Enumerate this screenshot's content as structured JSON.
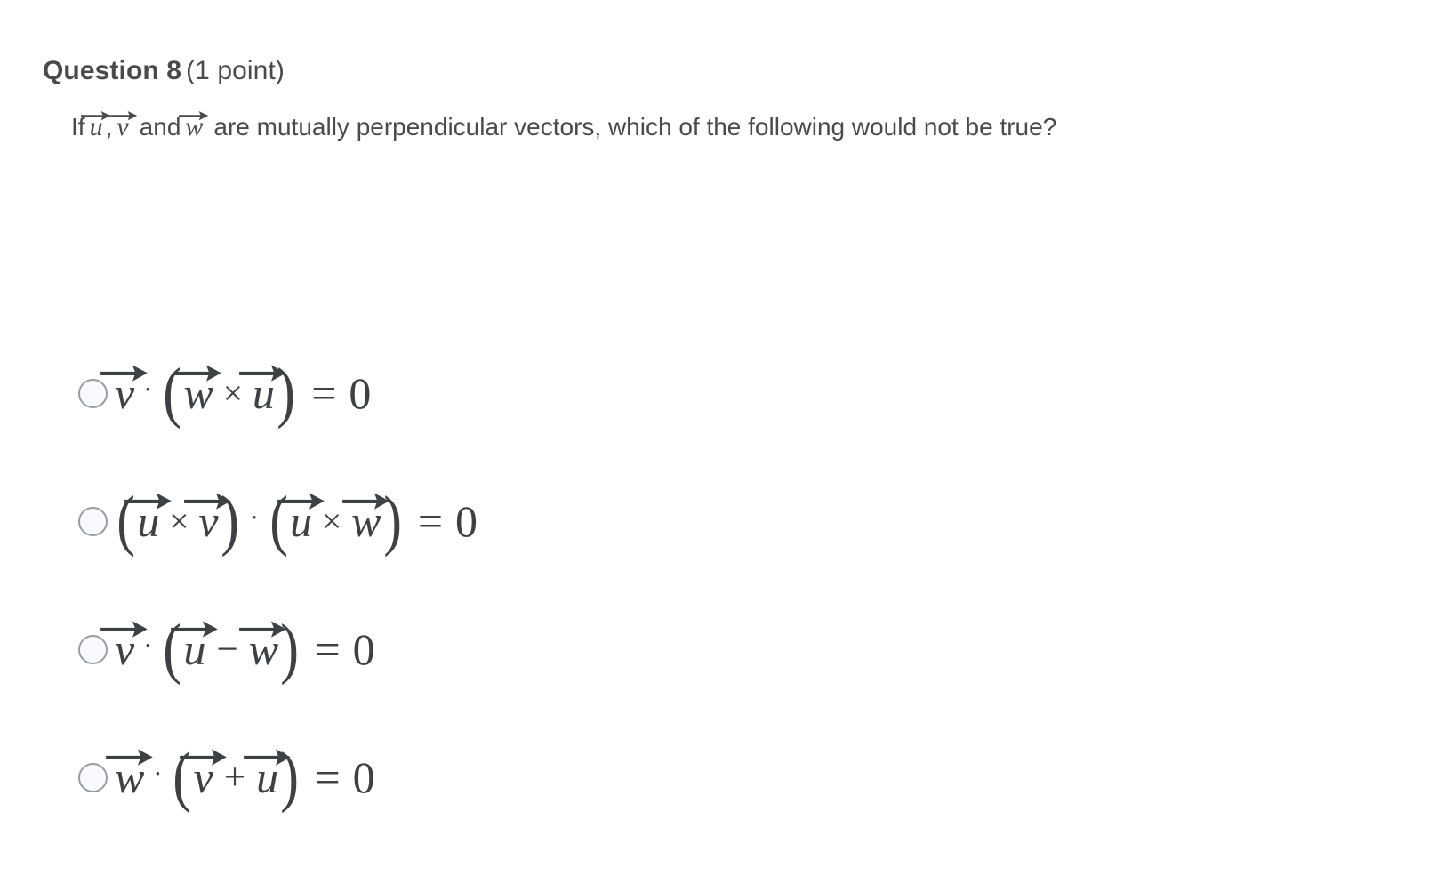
{
  "question": {
    "title": "Question 8",
    "points": "(1 point)",
    "prompt_prefix": "If",
    "prompt_sep1": ",",
    "prompt_and": "and",
    "prompt_rest": "are mutually perpendicular vectors, which of the following would not be true?",
    "prompt_vectors": [
      "u",
      "v",
      "w"
    ],
    "full_prompt": "If u⃗ , v⃗ and w⃗ are mutually perpendicular vectors, which of the following would not be true?"
  },
  "answers": [
    {
      "id": "option-a",
      "selected": false,
      "latex": "\\vec{v} \\cdot (\\vec{w} \\times \\vec{u}) = 0",
      "plain": "v⃗ · (w⃗ × u⃗) = 0",
      "tokens": [
        {
          "t": "vec",
          "v": "v"
        },
        {
          "t": "op",
          "v": "·",
          "cls": "op-dot"
        },
        {
          "t": "paren",
          "v": "("
        },
        {
          "t": "vec",
          "v": "w"
        },
        {
          "t": "op",
          "v": "×",
          "cls": "op-cross"
        },
        {
          "t": "vec",
          "v": "u"
        },
        {
          "t": "paren",
          "v": ")"
        },
        {
          "t": "op",
          "v": "=",
          "cls": "op-eq"
        },
        {
          "t": "num",
          "v": "0"
        }
      ]
    },
    {
      "id": "option-b",
      "selected": false,
      "latex": "(\\vec{u} \\times \\vec{v}) \\cdot (\\vec{u} \\times \\vec{w}) = 0",
      "plain": "(u⃗ × v⃗) · (u⃗ × w⃗) = 0",
      "tokens": [
        {
          "t": "paren",
          "v": "("
        },
        {
          "t": "vec",
          "v": "u"
        },
        {
          "t": "op",
          "v": "×",
          "cls": "op-cross"
        },
        {
          "t": "vec",
          "v": "v"
        },
        {
          "t": "paren",
          "v": ")"
        },
        {
          "t": "op",
          "v": "·",
          "cls": "op-dot"
        },
        {
          "t": "paren",
          "v": "("
        },
        {
          "t": "vec",
          "v": "u"
        },
        {
          "t": "op",
          "v": "×",
          "cls": "op-cross"
        },
        {
          "t": "vec",
          "v": "w"
        },
        {
          "t": "paren",
          "v": ")"
        },
        {
          "t": "op",
          "v": "=",
          "cls": "op-eq"
        },
        {
          "t": "num",
          "v": "0"
        }
      ]
    },
    {
      "id": "option-c",
      "selected": false,
      "latex": "\\vec{v} \\cdot (\\vec{u} - \\vec{w}) = 0",
      "plain": "v⃗ · (u⃗ − w⃗) = 0",
      "tokens": [
        {
          "t": "vec",
          "v": "v"
        },
        {
          "t": "op",
          "v": "·",
          "cls": "op-dot"
        },
        {
          "t": "paren",
          "v": "("
        },
        {
          "t": "vec",
          "v": "u"
        },
        {
          "t": "op",
          "v": "−",
          "cls": "op-minus"
        },
        {
          "t": "vec",
          "v": "w"
        },
        {
          "t": "paren",
          "v": ")"
        },
        {
          "t": "op",
          "v": "=",
          "cls": "op-eq"
        },
        {
          "t": "num",
          "v": "0"
        }
      ]
    },
    {
      "id": "option-d",
      "selected": false,
      "latex": "\\vec{w} \\cdot (\\vec{v} + \\vec{u}) = 0",
      "plain": "w⃗ · (v⃗ + u⃗) = 0",
      "tokens": [
        {
          "t": "vec",
          "v": "w"
        },
        {
          "t": "op",
          "v": "·",
          "cls": "op-dot"
        },
        {
          "t": "paren",
          "v": "("
        },
        {
          "t": "vec",
          "v": "v"
        },
        {
          "t": "op",
          "v": "+",
          "cls": "op-plus"
        },
        {
          "t": "vec",
          "v": "u"
        },
        {
          "t": "paren",
          "v": ")"
        },
        {
          "t": "op",
          "v": "=",
          "cls": "op-eq"
        },
        {
          "t": "num",
          "v": "0"
        }
      ]
    }
  ],
  "colors": {
    "background": "#ffffff",
    "text": "#4a4a4a",
    "math_text": "#3f4043",
    "radio_border": "#9b9ca2",
    "radio_fill": "#f7f9fd"
  }
}
